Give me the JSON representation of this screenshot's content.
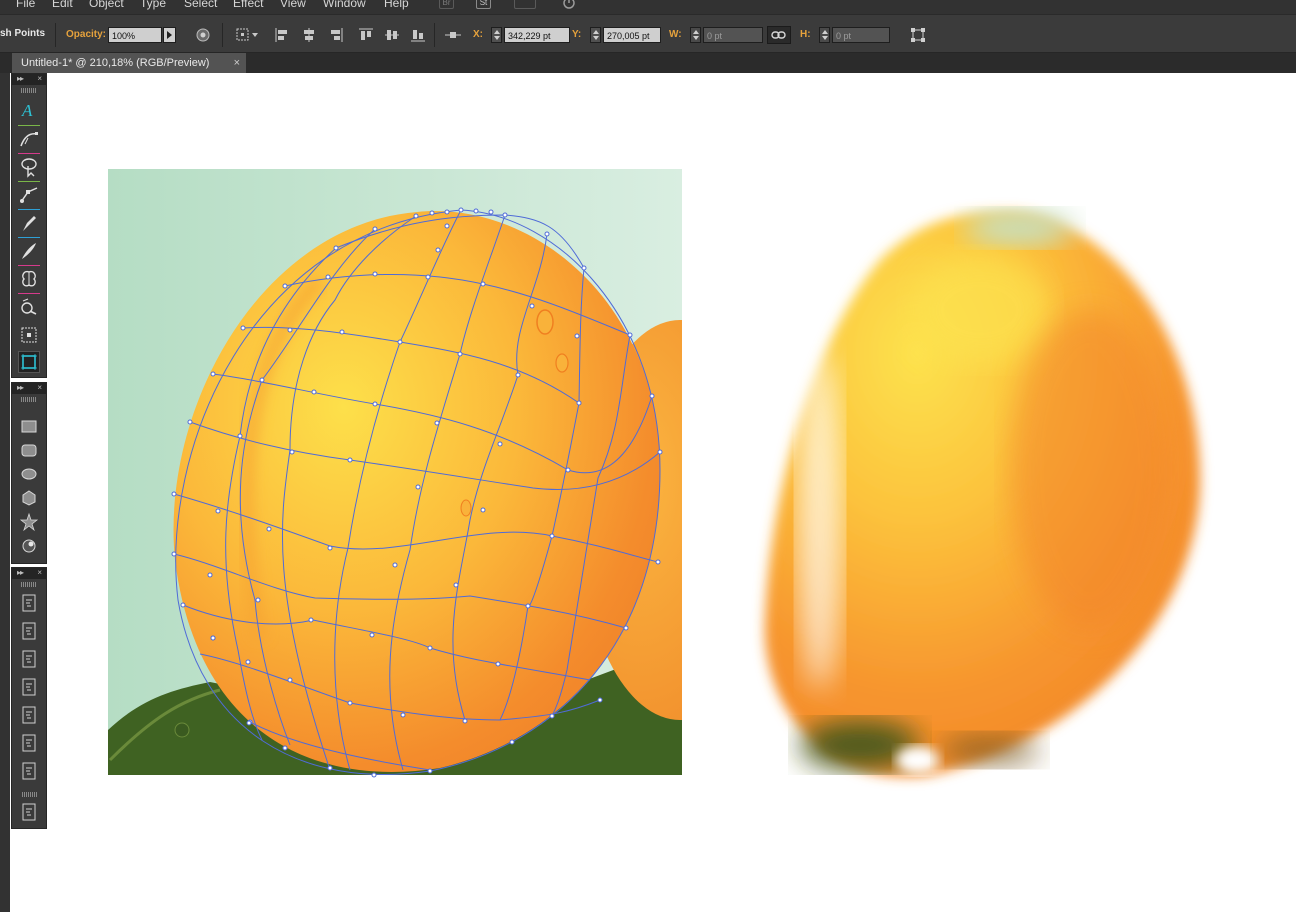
{
  "menu": {
    "items": [
      "File",
      "Edit",
      "Object",
      "Type",
      "Select",
      "Effect",
      "View",
      "Window",
      "Help"
    ],
    "icons": [
      "Br",
      "St"
    ]
  },
  "control_bar": {
    "mode_label": "sh Points",
    "opacity_label": "Opacity:",
    "opacity_value": "100%",
    "x_label": "X:",
    "x_value": "342,229 pt",
    "y_label": "Y:",
    "y_value": "270,005 pt",
    "w_label": "W:",
    "w_value": "0 pt",
    "h_label": "H:",
    "h_value": "0 pt"
  },
  "document": {
    "tab_title": "Untitled-1* @ 210,18% (RGB/Preview)",
    "close_glyph": "×"
  },
  "panel_icons": {
    "double_arrow": "▸▸",
    "close": "×"
  },
  "toolbar": {
    "tools": [
      "type-icon",
      "curvature-icon",
      "lasso-select-icon",
      "anchor-convert-icon",
      "pen-icon",
      "brush-icon",
      "puppet-warp-icon",
      "shaper-icon",
      "free-transform-icon",
      "artboard-icon"
    ],
    "shapes": [
      "rectangle-icon",
      "rounded-rectangle-icon",
      "ellipse-icon",
      "polygon-icon",
      "star-icon",
      "flare-icon"
    ],
    "symbols_count": 8
  },
  "colors": {
    "accent_orange": "#e6a23c",
    "mesh_line": "#4f6bd8",
    "ui_dark": "#3b3b3b"
  }
}
